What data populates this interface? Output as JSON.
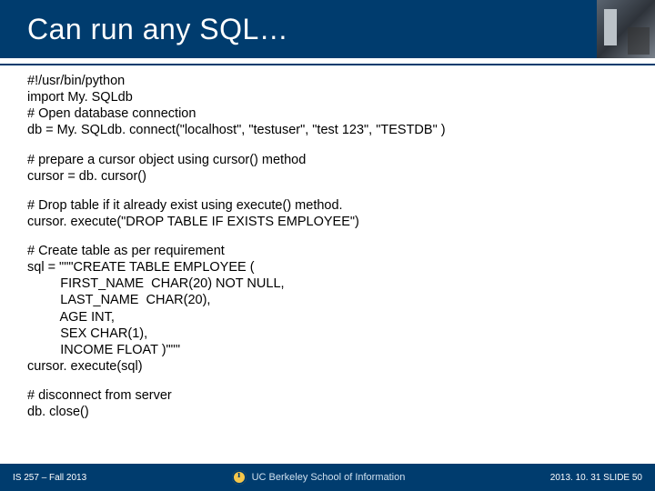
{
  "title": "Can run any SQL…",
  "code": {
    "block1": [
      "#!/usr/bin/python",
      "import My. SQLdb",
      "# Open database connection",
      "db = My. SQLdb. connect(\"localhost\", \"testuser\", \"test 123\", \"TESTDB\" )"
    ],
    "block2": [
      "# prepare a cursor object using cursor() method",
      "cursor = db. cursor()"
    ],
    "block3": [
      "# Drop table if it already exist using execute() method.",
      "cursor. execute(\"DROP TABLE IF EXISTS EMPLOYEE\")"
    ],
    "block4": [
      "# Create table as per requirement",
      "sql = \"\"\"CREATE TABLE EMPLOYEE (",
      "         FIRST_NAME  CHAR(20) NOT NULL,",
      "         LAST_NAME  CHAR(20),",
      "         AGE INT,",
      "         SEX CHAR(1),",
      "         INCOME FLOAT )\"\"\"",
      "cursor. execute(sql)"
    ],
    "block5": [
      "# disconnect from server",
      "db. close()"
    ]
  },
  "footer": {
    "left": "IS 257 – Fall 2013",
    "center": "UC Berkeley School of Information",
    "right": "2013. 10. 31 SLIDE 50"
  }
}
